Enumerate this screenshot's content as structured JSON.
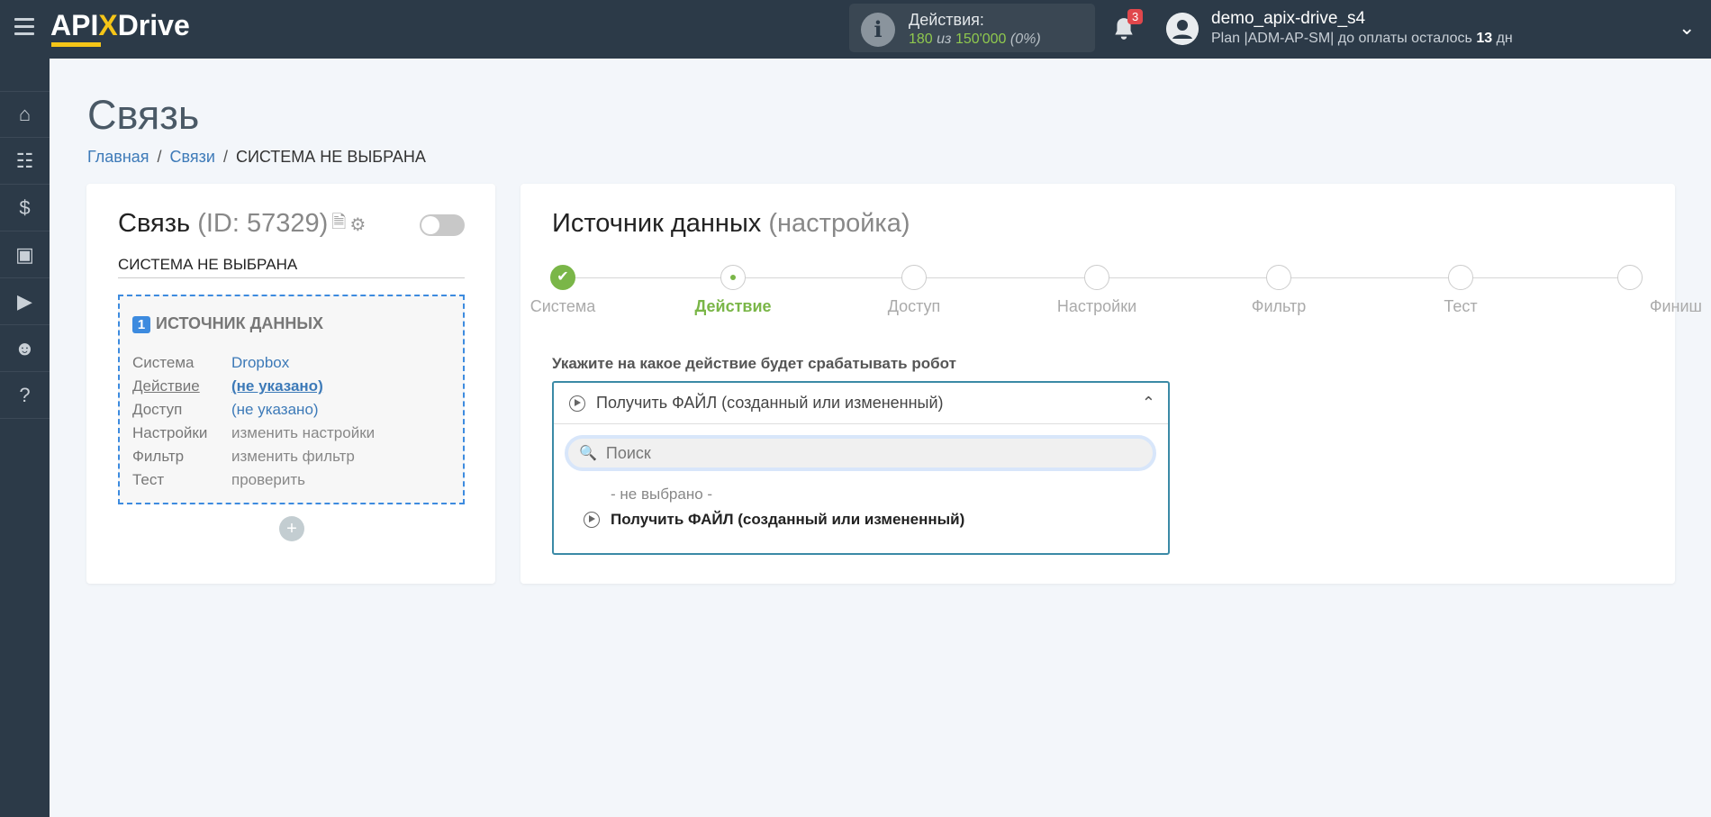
{
  "header": {
    "logo": "APIXDrive",
    "actions_label": "Действия:",
    "actions_used": "180",
    "actions_of": "из",
    "actions_total": "150'000",
    "actions_pct": "(0%)",
    "notifications": "3",
    "username": "demo_apix-drive_s4",
    "plan_prefix": "Plan |ADM-AP-SM| до оплаты осталось",
    "plan_days": "13",
    "plan_suffix": "дн"
  },
  "sidebar": {
    "items": [
      {
        "icon": "home-icon"
      },
      {
        "icon": "sitemap-icon"
      },
      {
        "icon": "dollar-icon"
      },
      {
        "icon": "briefcase-icon"
      },
      {
        "icon": "youtube-icon"
      },
      {
        "icon": "user-icon"
      },
      {
        "icon": "help-icon"
      }
    ]
  },
  "page": {
    "title": "Связь",
    "breadcrumb": [
      "Главная",
      "Связи",
      "СИСТЕМА НЕ ВЫБРАНА"
    ]
  },
  "left": {
    "title": "Связь",
    "id": "(ID: 57329)",
    "system_name": "СИСТЕМА НЕ ВЫБРАНА",
    "source_num": "1",
    "source_title": "ИСТОЧНИК ДАННЫХ",
    "rows": [
      {
        "k": "Система",
        "v": "Dropbox"
      },
      {
        "k": "Действие",
        "v": "(не указано)"
      },
      {
        "k": "Доступ",
        "v": "(не указано)"
      },
      {
        "k": "Настройки",
        "v": "изменить настройки"
      },
      {
        "k": "Фильтр",
        "v": "изменить фильтр"
      },
      {
        "k": "Тест",
        "v": "проверить"
      }
    ],
    "add": "+"
  },
  "right": {
    "title": "Источник данных",
    "subtitle": "(настройка)",
    "steps": [
      "Система",
      "Действие",
      "Доступ",
      "Настройки",
      "Фильтр",
      "Тест",
      "Финиш"
    ],
    "question": "Укажите на какое действие будет срабатывать робот",
    "selected": "Получить ФАЙЛ (созданный или измененный)",
    "search_placeholder": "Поиск",
    "options": [
      "- не выбрано -",
      "Получить ФАЙЛ (созданный или измененный)"
    ]
  }
}
